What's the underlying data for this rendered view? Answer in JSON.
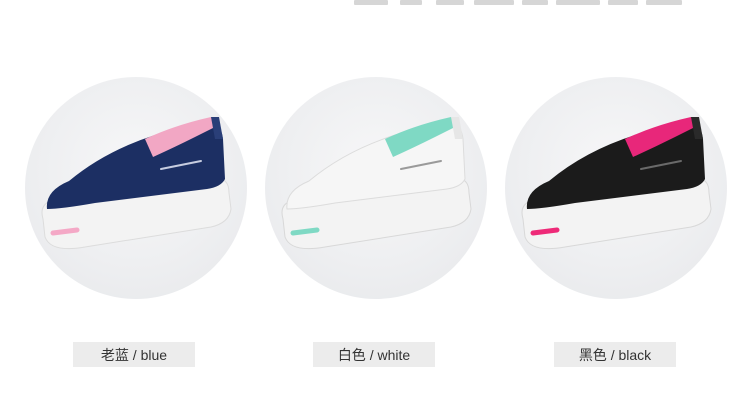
{
  "products": [
    {
      "label": "老蓝 / blue",
      "upper_color": "#1c2f63",
      "lining_color": "#f2a7c4",
      "stripe_color": "#f4a8c6"
    },
    {
      "label": "白色 / white",
      "upper_color": "#f6f6f6",
      "lining_color": "#7fd9c4",
      "stripe_color": "#7fd9c4"
    },
    {
      "label": "黑色 / black",
      "upper_color": "#1b1b1b",
      "lining_color": "#e8277a",
      "stripe_color": "#ee2a78"
    }
  ],
  "colors": {
    "label_bg": "#ececec",
    "circle_bg": "#eeeff1",
    "sole": "#f3f3f3"
  }
}
